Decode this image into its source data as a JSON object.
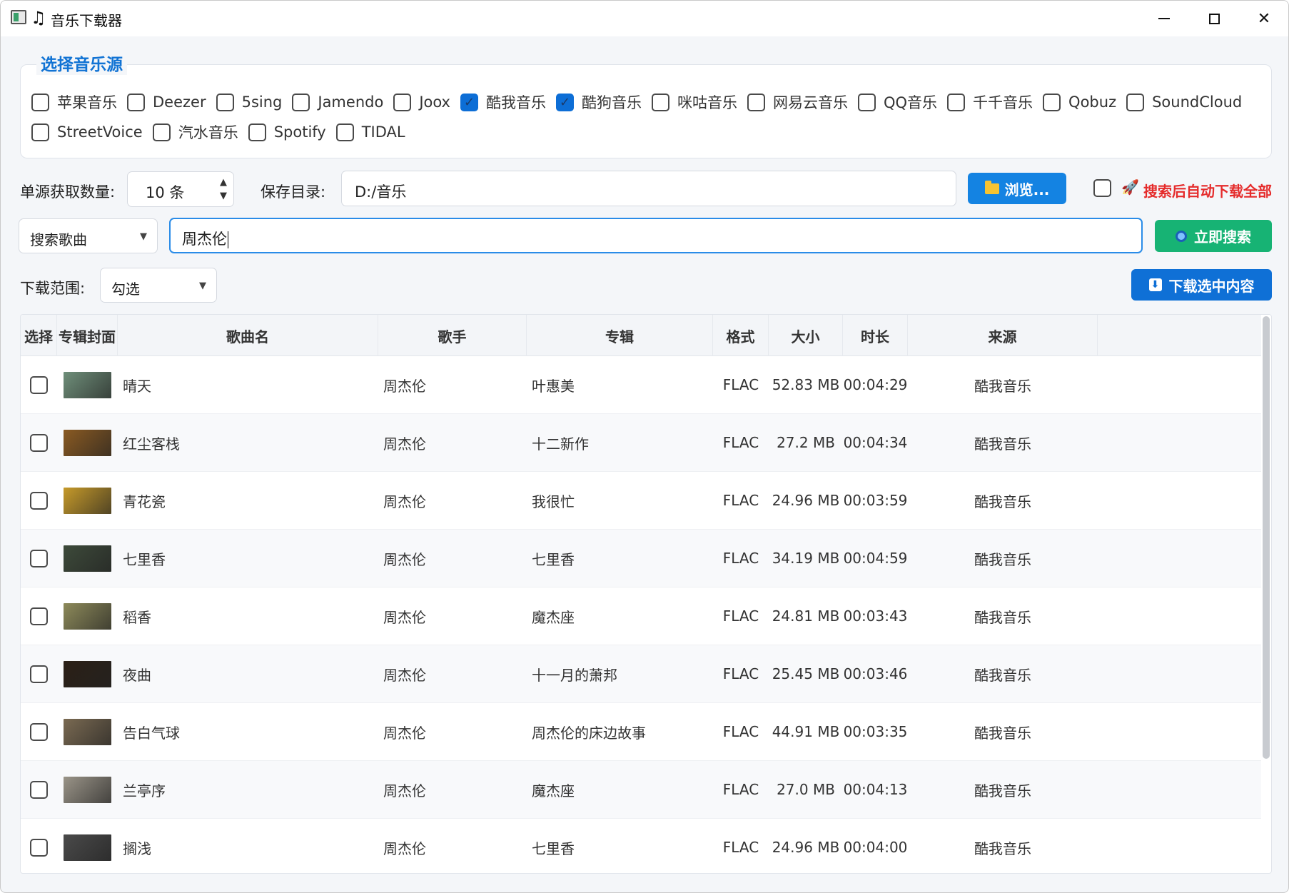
{
  "window": {
    "title": "音乐下载器",
    "app_icon": "app-window-icon",
    "note_icon": "♫",
    "minimize_icon": "minimize-icon",
    "maximize_icon": "maximize-icon",
    "close_icon": "✕"
  },
  "sources": {
    "legend": "选择音乐源",
    "row1": [
      {
        "label": "苹果音乐",
        "checked": false
      },
      {
        "label": "Deezer",
        "checked": false
      },
      {
        "label": "5sing",
        "checked": false
      },
      {
        "label": "Jamendo",
        "checked": false
      },
      {
        "label": "Joox",
        "checked": false
      },
      {
        "label": "酷我音乐",
        "checked": true
      },
      {
        "label": "酷狗音乐",
        "checked": true
      },
      {
        "label": "咪咕音乐",
        "checked": false
      },
      {
        "label": "网易云音乐",
        "checked": false
      },
      {
        "label": "QQ音乐",
        "checked": false
      },
      {
        "label": "千千音乐",
        "checked": false
      },
      {
        "label": "Qobuz",
        "checked": false
      },
      {
        "label": "SoundCloud",
        "checked": false
      }
    ],
    "row2": [
      {
        "label": "StreetVoice",
        "checked": false
      },
      {
        "label": "汽水音乐",
        "checked": false
      },
      {
        "label": "Spotify",
        "checked": false
      },
      {
        "label": "TIDAL",
        "checked": false
      }
    ]
  },
  "settings": {
    "count_label": "单源获取数量:",
    "count_value": "10 条",
    "dir_label": "保存目录:",
    "dir_value": "D:/音乐",
    "browse_label": "浏览...",
    "auto_download_label": "搜索后自动下载全部",
    "auto_download_checked": false,
    "rocket_icon": "🚀"
  },
  "search": {
    "type_value": "搜索歌曲",
    "query": "周杰伦",
    "button_label": "立即搜索"
  },
  "download": {
    "range_label": "下载范围:",
    "range_value": "勾选",
    "button_label": "下载选中内容",
    "icon": "⬇"
  },
  "table": {
    "headers": [
      "选择",
      "专辑封面",
      "歌曲名",
      "歌手",
      "专辑",
      "格式",
      "大小",
      "时长",
      "来源"
    ],
    "rows": [
      {
        "title": "晴天",
        "artist": "周杰伦",
        "album": "叶惠美",
        "format": "FLAC",
        "size": "52.83 MB",
        "duration": "00:04:29",
        "source": "酷我音乐",
        "cover_color": "#6f8f7a"
      },
      {
        "title": "红尘客栈",
        "artist": "周杰伦",
        "album": "十二新作",
        "format": "FLAC",
        "size": "27.2 MB",
        "duration": "00:04:34",
        "source": "酷我音乐",
        "cover_color": "#8a5a22"
      },
      {
        "title": "青花瓷",
        "artist": "周杰伦",
        "album": "我很忙",
        "format": "FLAC",
        "size": "24.96 MB",
        "duration": "00:03:59",
        "source": "酷我音乐",
        "cover_color": "#c69a2a"
      },
      {
        "title": "七里香",
        "artist": "周杰伦",
        "album": "七里香",
        "format": "FLAC",
        "size": "34.19 MB",
        "duration": "00:04:59",
        "source": "酷我音乐",
        "cover_color": "#3d4a3a"
      },
      {
        "title": "稻香",
        "artist": "周杰伦",
        "album": "魔杰座",
        "format": "FLAC",
        "size": "24.81 MB",
        "duration": "00:03:43",
        "source": "酷我音乐",
        "cover_color": "#8d8a5a"
      },
      {
        "title": "夜曲",
        "artist": "周杰伦",
        "album": "十一月的萧邦",
        "format": "FLAC",
        "size": "25.45 MB",
        "duration": "00:03:46",
        "source": "酷我音乐",
        "cover_color": "#2b2016"
      },
      {
        "title": "告白气球",
        "artist": "周杰伦",
        "album": "周杰伦的床边故事",
        "format": "FLAC",
        "size": "44.91 MB",
        "duration": "00:03:35",
        "source": "酷我音乐",
        "cover_color": "#7a6a52"
      },
      {
        "title": "兰亭序",
        "artist": "周杰伦",
        "album": "魔杰座",
        "format": "FLAC",
        "size": "27.0 MB",
        "duration": "00:04:13",
        "source": "酷我音乐",
        "cover_color": "#9a9488"
      },
      {
        "title": "搁浅",
        "artist": "周杰伦",
        "album": "七里香",
        "format": "FLAC",
        "size": "24.96 MB",
        "duration": "00:04:00",
        "source": "酷我音乐",
        "cover_color": "#4a4a4a"
      }
    ]
  },
  "colors": {
    "accent_blue": "#1483e2",
    "search_green": "#17b374",
    "alert_red": "#e52b2b",
    "legend_blue": "#1173d4"
  }
}
